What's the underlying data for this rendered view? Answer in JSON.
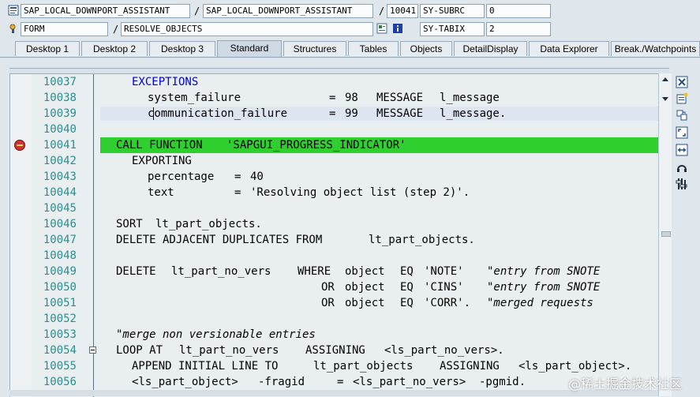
{
  "info": {
    "row1": {
      "program": "SAP_LOCAL_DOWNPORT_ASSISTANT",
      "include": "SAP_LOCAL_DOWNPORT_ASSISTANT",
      "line": "10041",
      "var_name": "SY-SUBRC",
      "var_value": "0"
    },
    "row2": {
      "event_type": "FORM",
      "event_name": "RESOLVE_OBJECTS",
      "var_name": "SY-TABIX",
      "var_value": "2"
    },
    "separator": "/"
  },
  "tabs": [
    {
      "label": "Desktop 1"
    },
    {
      "label": "Desktop 2"
    },
    {
      "label": "Desktop 3"
    },
    {
      "label": "Standard",
      "active": true
    },
    {
      "label": "Structures"
    },
    {
      "label": "Tables"
    },
    {
      "label": "Objects"
    },
    {
      "label": "DetailDisplay"
    },
    {
      "label": "Data Explorer"
    },
    {
      "label": "Break./Watchpoints"
    }
  ],
  "code_lines": [
    {
      "num": "10037"
    },
    {
      "num": "10038"
    },
    {
      "num": "10039"
    },
    {
      "num": "10040"
    },
    {
      "num": "10041"
    },
    {
      "num": "10042"
    },
    {
      "num": "10043"
    },
    {
      "num": "10044"
    },
    {
      "num": "10045"
    },
    {
      "num": "10046"
    },
    {
      "num": "10047"
    },
    {
      "num": "10048"
    },
    {
      "num": "10049"
    },
    {
      "num": "10050"
    },
    {
      "num": "10051"
    },
    {
      "num": "10052"
    },
    {
      "num": "10053"
    },
    {
      "num": "10054"
    },
    {
      "num": "10055"
    },
    {
      "num": "10056"
    }
  ],
  "code": {
    "l10037": [
      "EXCEPTIONS"
    ],
    "l10038": [
      "system_failure",
      "=",
      "98",
      "MESSAGE",
      "l_message"
    ],
    "l10039": [
      "communication_failure",
      "=",
      "99",
      "MESSAGE",
      "l_message."
    ],
    "l10041": [
      "CALL FUNCTION",
      "'SAPGUI_PROGRESS_INDICATOR'"
    ],
    "l10042": [
      "EXPORTING"
    ],
    "l10043": [
      "percentage",
      "=",
      "40"
    ],
    "l10044": [
      "text",
      "=",
      "'Resolving object list (step 2)'."
    ],
    "l10046": [
      "SORT",
      "lt_part_objects."
    ],
    "l10047": [
      "DELETE ADJACENT DUPLICATES FROM",
      "lt_part_objects."
    ],
    "l10049": [
      "DELETE",
      "lt_part_no_vers",
      "WHERE",
      "object",
      "EQ",
      "'NOTE'",
      "\"entry from SNOTE"
    ],
    "l10050": [
      "OR",
      "object",
      "EQ",
      "'CINS'",
      "\"entry from SNOTE"
    ],
    "l10051": [
      "OR",
      "object",
      "EQ",
      "'CORR'.",
      "\"merged requests"
    ],
    "l10053": [
      "\"merge non versionable entries"
    ],
    "l10054": [
      "LOOP AT",
      "lt_part_no_vers",
      "ASSIGNING",
      "<ls_part_no_vers>."
    ],
    "l10055": [
      "APPEND INITIAL LINE TO",
      "lt_part_objects",
      "ASSIGNING",
      "<ls_part_object>."
    ],
    "l10056": [
      "<ls_part_object>",
      "-fragid",
      "=",
      "<ls_part_no_vers>",
      "-pgmid."
    ]
  },
  "execution_line": "10041",
  "breakpoint_line": "10041",
  "colors": {
    "keyword": "#0000e6",
    "number": "#3c8cff",
    "string": "#3c8a2a",
    "comment": "#707070",
    "exec_highlight": "#2fcf2f",
    "line_number": "#2d8c8c"
  },
  "watermark": "@稀土掘金技术社区"
}
